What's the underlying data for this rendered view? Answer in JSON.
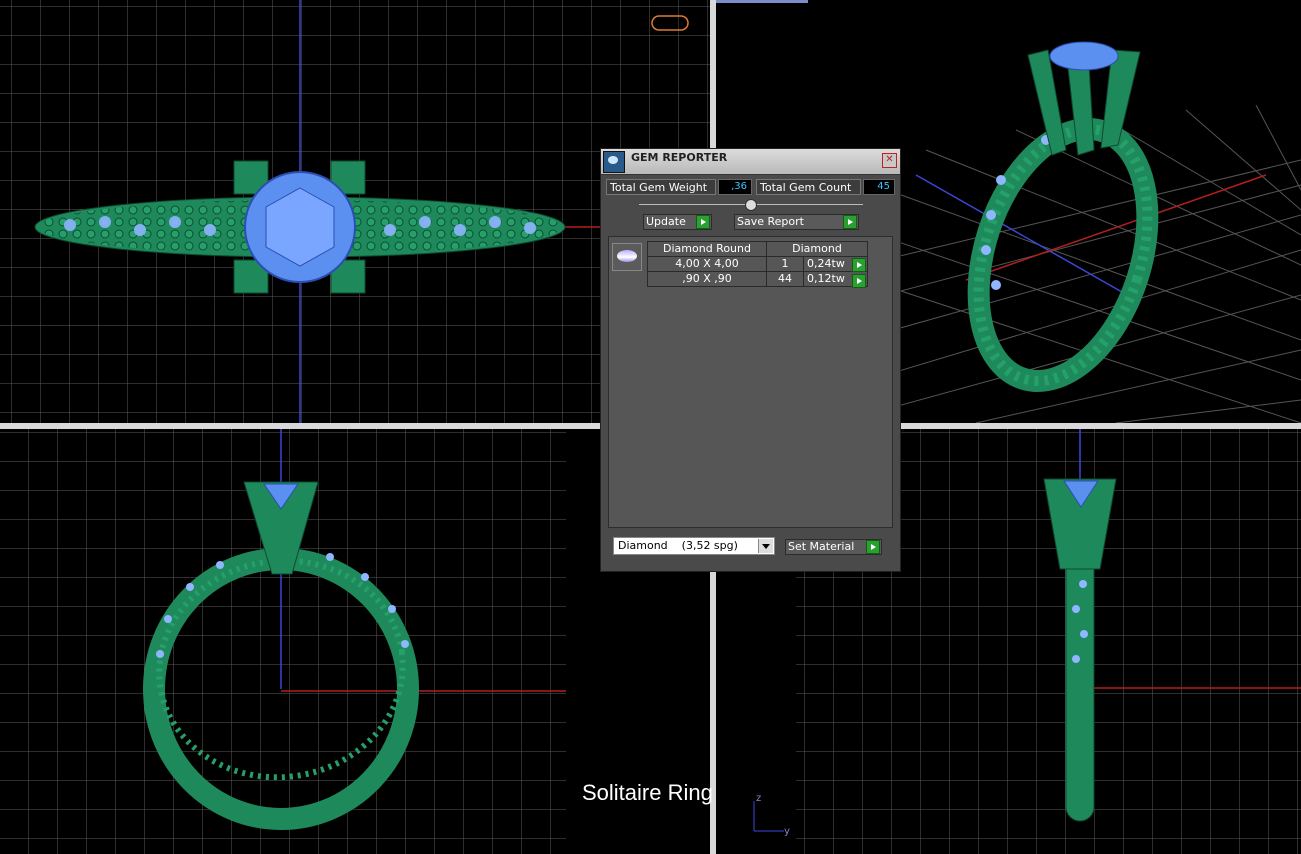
{
  "dialog": {
    "title": "GEM REPORTER",
    "close_label": "✕",
    "total_gem_weight_label": "Total Gem Weight",
    "total_gem_weight_value": ",36",
    "total_gem_count_label": "Total Gem Count",
    "total_gem_count_value": "45",
    "update_label": "Update",
    "save_report_label": "Save Report",
    "table": {
      "headers": [
        "Diamond Round",
        "Diamond"
      ],
      "rows": [
        {
          "size": "4,00 X 4,00",
          "count": "1",
          "weight": "0,24tw"
        },
        {
          "size": ",90 X ,90",
          "count": "44",
          "weight": "0,12tw"
        }
      ]
    },
    "material_select_value": "Diamond    (3,52 spg)",
    "set_material_label": "Set Material"
  },
  "caption": "Solitaire Ring",
  "axis": {
    "z": "z",
    "y": "y"
  },
  "colors": {
    "metal": "#1e8a5c",
    "gem": "#5b8ff0",
    "grid": "#5c5c5c",
    "axis_blue": "#3a46d8",
    "axis_red": "#b02020"
  }
}
